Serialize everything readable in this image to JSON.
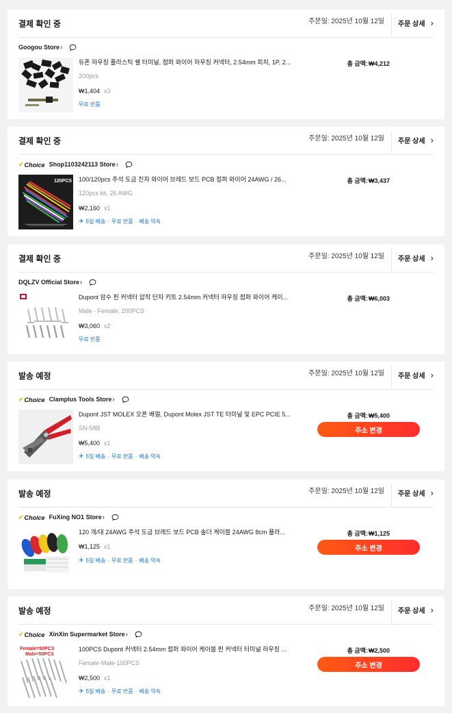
{
  "orders": [
    {
      "status": "결제 확인 중",
      "date": "주문일: 2025년 10월 12일",
      "detail_label": "주문 상세",
      "choice": false,
      "store": "Googou Store",
      "title": "듀폰 하우징 플라스틱 쉘 터미널, 점퍼 와이어 하우징 커넥터, 2.54mm 피치, 1P, 2...",
      "sku": "200pcs",
      "price": "₩1,404",
      "qty": "x3",
      "tags": [
        "무료 반품"
      ],
      "total_label": "총 금액:",
      "total": "₩4,212",
      "thumb": "black-housings",
      "button": null
    },
    {
      "status": "결제 확인 중",
      "date": "주문일: 2025년 10월 12일",
      "detail_label": "주문 상세",
      "choice": true,
      "store": "Shop1103242113 Store",
      "title": "100/120pcs 주석 도금 진자 와이어 브레드 보드 PCB 점퍼 와이어 24AWG / 26...",
      "sku": "120pcs kit, 26 AWG",
      "price": "₩2,160",
      "qty": "x1",
      "tags": [
        "5일 배송",
        "무료 반품",
        "배송 약속"
      ],
      "total_label": "총 금액:",
      "total": "₩3,437",
      "thumb": "wire-kit",
      "thumb_text": "120PCS",
      "button": null
    },
    {
      "status": "결제 확인 중",
      "date": "주문일: 2025년 10월 12일",
      "detail_label": "주문 상세",
      "choice": false,
      "store": "DQLZV Official Store",
      "title": "Dupont 암수 핀 커넥터 압착 단자 키트 2.54mm 커넥터 하우징 점퍼 와이어 케이...",
      "sku": "Male - Female, 200PCS",
      "price": "₩3,060",
      "qty": "x2",
      "tags": [
        "무료 반품"
      ],
      "total_label": "총 금액:",
      "total": "₩6,003",
      "thumb": "pins",
      "button": null
    },
    {
      "status": "발송 예정",
      "date": "주문일: 2025년 10월 12일",
      "detail_label": "주문 상세",
      "choice": true,
      "store": "Clamplus Tools Store",
      "title": "Dupont JST MOLEX 오픈 배럴, Dupont Molex JST TE 터미널 및 EPC PCIE 5...",
      "sku": "SN-58B",
      "price": "₩5,400",
      "qty": "x1",
      "tags": [
        "5일 배송",
        "무료 반품",
        "배송 약속"
      ],
      "total_label": "총 금액:",
      "total": "₩5,400",
      "thumb": "crimper",
      "button": "주소 변경"
    },
    {
      "status": "발송 예정",
      "date": "주문일: 2025년 10월 12일",
      "detail_label": "주문 상세",
      "choice": true,
      "store": "FuXing NO1 Store",
      "title": "120 개/대 24AWG 주석 도금 브레드 보드 PCB 솔더 케이블 24AWG 8cm 플라...",
      "sku": "",
      "price": "₩1,125",
      "qty": "x1",
      "tags": [
        "5일 배송",
        "무료 반품",
        "배송 약속"
      ],
      "total_label": "총 금액:",
      "total": "₩1,125",
      "thumb": "wire-bundles",
      "button": "주소 변경"
    },
    {
      "status": "발송 예정",
      "date": "주문일: 2025년 10월 12일",
      "detail_label": "주문 상세",
      "choice": true,
      "store": "XinXin Supermarket Store",
      "title": "100PCS Dupont 커넥터 2.54mm 점퍼 와이어 케이블 핀 커넥터 터미널 하우징 ...",
      "sku": "Female-Male-100PCS",
      "price": "₩2,500",
      "qty": "x1",
      "tags": [
        "5일 배송",
        "무료 반품",
        "배송 약속"
      ],
      "total_label": "총 금액:",
      "total": "₩2,500",
      "thumb": "pins-labeled",
      "thumb_text": [
        "Female=50PCS",
        "Male=50PCS"
      ],
      "button": "주소 변경"
    }
  ],
  "choice_label": "Choice",
  "colors": {
    "accent_start": "#ff5a14",
    "accent_end": "#ff2d2d",
    "tag_blue": "#1a6fd1",
    "choice_tick": "#f5a500"
  }
}
